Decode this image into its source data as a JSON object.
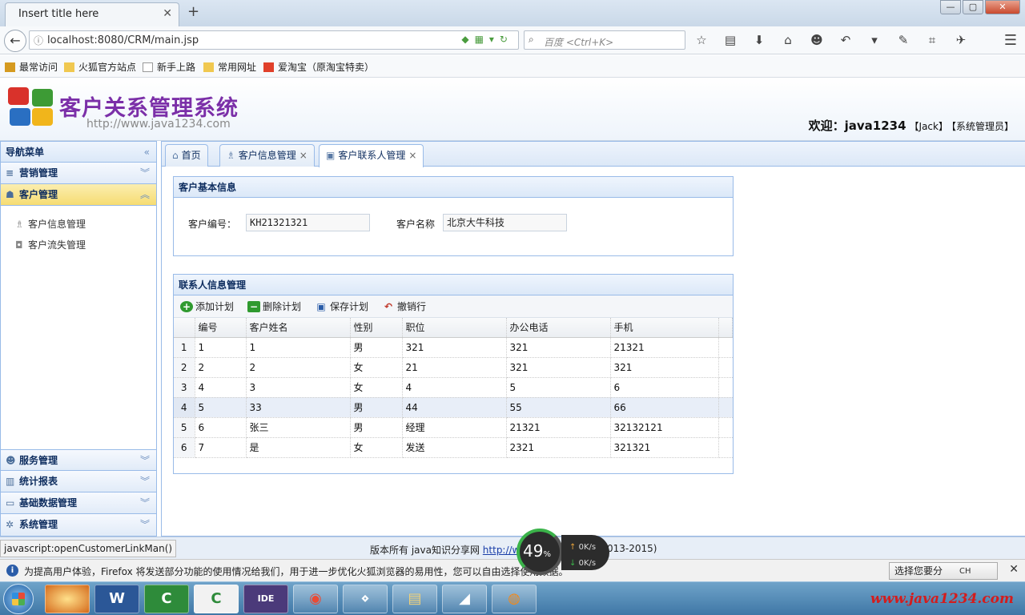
{
  "browser": {
    "tab_title": "Insert title here",
    "tab_close": "✕",
    "new_tab": "+",
    "url": "localhost:8080/CRM/main.jsp",
    "search_placeholder": "百度 <Ctrl+K>",
    "window_buttons": [
      "—",
      "▢",
      "✕"
    ]
  },
  "bookmarks": [
    {
      "label": "最常访问",
      "icon_color": "#d59a20"
    },
    {
      "label": "火狐官方站点",
      "icon_color": "#f0c850"
    },
    {
      "label": "新手上路",
      "icon_color": "#ffffff"
    },
    {
      "label": "常用网址",
      "icon_color": "#f0c850"
    },
    {
      "label": "爱淘宝（原淘宝特卖）",
      "icon_color": "#e0402a"
    }
  ],
  "app": {
    "title": "客户关系管理系统",
    "url": "http://www.java1234.com",
    "welcome_main": "欢迎：java1234",
    "welcome_user": "【Jack】",
    "welcome_role": "【系统管理员】"
  },
  "sidebar": {
    "header": "导航菜单",
    "collapse_glyph": "«",
    "panels_top": [
      {
        "label": "营销管理",
        "icon": "≡",
        "chev": "︾"
      },
      {
        "label": "客户管理",
        "icon": "☗",
        "chev": "︽"
      }
    ],
    "sub_items": [
      {
        "label": "客户信息管理",
        "icon": "♗"
      },
      {
        "label": "客户流失管理",
        "icon": "◘"
      }
    ],
    "panels_bottom": [
      {
        "label": "服务管理",
        "icon": "☻",
        "chev": "︾"
      },
      {
        "label": "统计报表",
        "icon": "▥",
        "chev": "︾"
      },
      {
        "label": "基础数据管理",
        "icon": "▭",
        "chev": "︾"
      },
      {
        "label": "系统管理",
        "icon": "✲",
        "chev": "︾"
      }
    ]
  },
  "tabs": [
    {
      "label": "首页",
      "icon": "⌂",
      "closable": false
    },
    {
      "label": "客户信息管理",
      "icon": "♗",
      "close": "×"
    },
    {
      "label": "客户联系人管理",
      "icon": "▣",
      "close": "×"
    }
  ],
  "customer_info": {
    "title": "客户基本信息",
    "code_label": "客户编号：",
    "code_value": "KH21321321",
    "name_label": "客户名称",
    "name_value": "北京大牛科技"
  },
  "contacts": {
    "title": "联系人信息管理",
    "toolbar": [
      {
        "label": "添加计划",
        "icon": "+",
        "color": "#2f9a2f"
      },
      {
        "label": "删除计划",
        "icon": "−",
        "color": "#2f9a2f"
      },
      {
        "label": "保存计划",
        "icon": "▣",
        "color": "#2a5ca8"
      },
      {
        "label": "撤销行",
        "icon": "↶",
        "color": "#c0392b"
      }
    ],
    "columns": [
      "编号",
      "客户姓名",
      "性别",
      "职位",
      "办公电话",
      "手机"
    ],
    "rows": [
      {
        "n": "1",
        "cells": [
          "1",
          "1",
          "男",
          "321",
          "321",
          "21321"
        ]
      },
      {
        "n": "2",
        "cells": [
          "2",
          "2",
          "女",
          "21",
          "321",
          "321"
        ]
      },
      {
        "n": "3",
        "cells": [
          "4",
          "3",
          "女",
          "4",
          "5",
          "6"
        ]
      },
      {
        "n": "4",
        "cells": [
          "5",
          "33",
          "男",
          "44",
          "55",
          "66"
        ]
      },
      {
        "n": "5",
        "cells": [
          "6",
          "张三",
          "男",
          "经理",
          "21321",
          "32132121"
        ]
      },
      {
        "n": "6",
        "cells": [
          "7",
          "是",
          "女",
          "发送",
          "2321",
          "321321"
        ]
      }
    ]
  },
  "footer": {
    "status_link": "javascript:openCustomerLinkMan()",
    "copyright": "版本所有 java知识分享网",
    "copyright_link": "http://w",
    "copyright_tail": "013-2015)"
  },
  "notification": {
    "icon": "i",
    "text": "为提高用户体验，Firefox 将发送部分功能的使用情况给我们，用于进一步优化火狐浏览器的易用性，您可以自由选择",
    "text_tail": "使用数据。",
    "button": "选择您要分",
    "close": "✕"
  },
  "widget": {
    "percent": "49",
    "up": "0K/s",
    "down": "0K/s"
  },
  "taskbar": {
    "apps": [
      "W",
      "C",
      "C",
      "IDE",
      "◉",
      "⋄",
      "▤",
      "◢",
      "◍"
    ],
    "watermark": "www.java1234.com",
    "ime": "CH"
  }
}
